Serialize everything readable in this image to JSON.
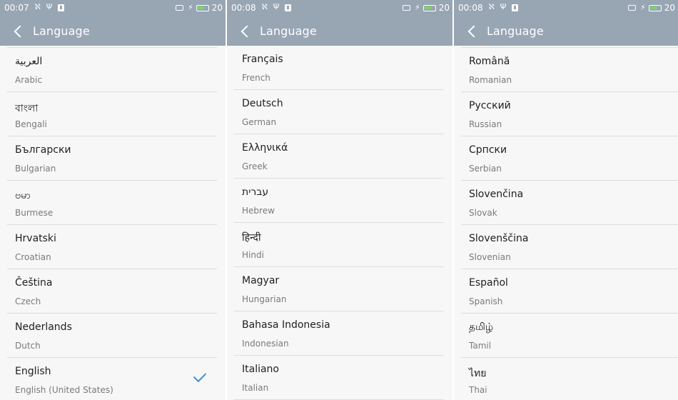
{
  "screen_title": "Language",
  "panels": [
    {
      "time": "00:07",
      "battery": "20",
      "items": [
        {
          "native": "العربية",
          "english": "Arabic"
        },
        {
          "native": "বাংলা",
          "english": "Bengali"
        },
        {
          "native": "Български",
          "english": "Bulgarian"
        },
        {
          "native": "ဗမာ",
          "english": "Burmese"
        },
        {
          "native": "Hrvatski",
          "english": "Croatian"
        },
        {
          "native": "Čeština",
          "english": "Czech"
        },
        {
          "native": "Nederlands",
          "english": "Dutch"
        },
        {
          "native": "English",
          "english": "English (United States)",
          "selected": true
        }
      ]
    },
    {
      "time": "00:08",
      "battery": "20",
      "items": [
        {
          "native": "Français",
          "english": "French"
        },
        {
          "native": "Deutsch",
          "english": "German"
        },
        {
          "native": "Ελληνικά",
          "english": "Greek"
        },
        {
          "native": "עברית",
          "english": "Hebrew"
        },
        {
          "native": "हिन्दी",
          "english": "Hindi"
        },
        {
          "native": "Magyar",
          "english": "Hungarian"
        },
        {
          "native": "Bahasa Indonesia",
          "english": "Indonesian"
        },
        {
          "native": "Italiano",
          "english": "Italian"
        }
      ]
    },
    {
      "time": "00:08",
      "battery": "20",
      "items": [
        {
          "native": "Română",
          "english": "Romanian"
        },
        {
          "native": "Русский",
          "english": "Russian"
        },
        {
          "native": "Српски",
          "english": "Serbian"
        },
        {
          "native": "Slovenčina",
          "english": "Slovak"
        },
        {
          "native": "Slovenščina",
          "english": "Slovenian"
        },
        {
          "native": "Español",
          "english": "Spanish"
        },
        {
          "native": "தமிழ்",
          "english": "Tamil"
        },
        {
          "native": "ไทย",
          "english": "Thai"
        }
      ]
    }
  ],
  "colors": {
    "header_bg": "#98a5b3",
    "check": "#3d90d6",
    "battery_fill": "#7fd36a"
  },
  "icons": [
    "back-arrow-icon",
    "usb-share-icon",
    "usb-icon",
    "notification-icon",
    "screen-icon",
    "charging-icon",
    "battery-icon",
    "checkmark-icon"
  ]
}
